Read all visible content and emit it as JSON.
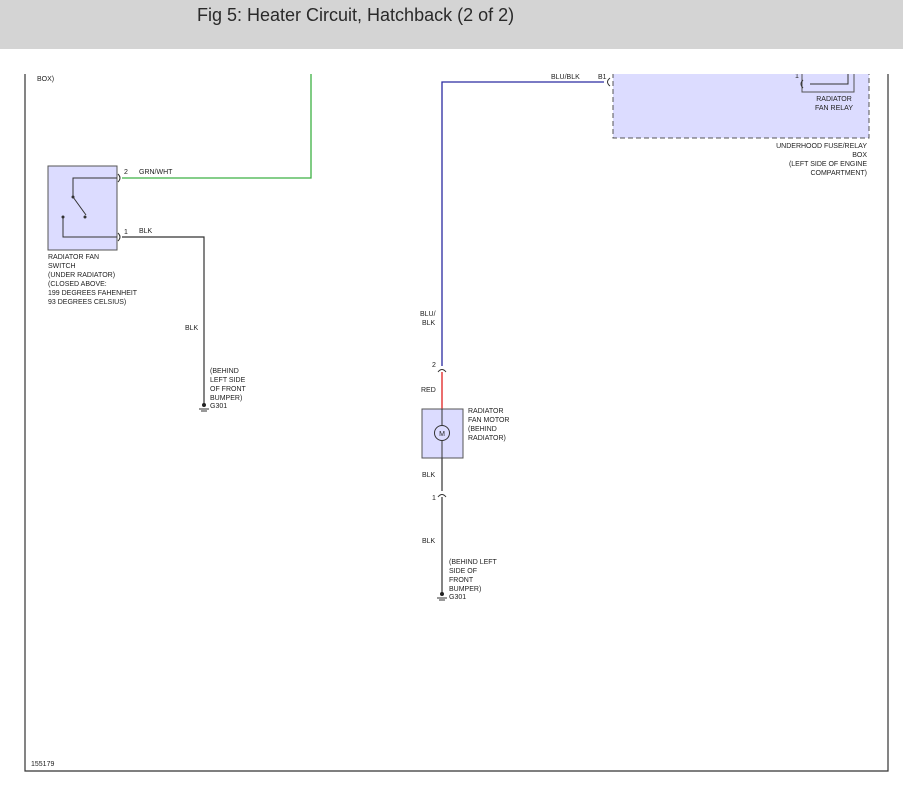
{
  "header": {
    "title": "Fig 5: Heater Circuit, Hatchback (2 of 2)"
  },
  "diagram": {
    "top_left_fragment": "BOX)",
    "switch": {
      "lines": [
        "RADIATOR FAN",
        "SWITCH",
        "(UNDER RADIATOR)",
        "(CLOSED ABOVE:",
        "199 DEGREES FAHENHEIT",
        "93 DEGREES CELSIUS)"
      ],
      "pin2": "2",
      "pin1": "1"
    },
    "wires": {
      "grn_wht": "GRN/WHT",
      "blk_top": "BLK",
      "blk_vertical": "BLK",
      "blu_blk_top": "BLU/BLK",
      "blu_blk_side_1": "BLU/",
      "blu_blk_side_2": "BLK",
      "red": "RED",
      "blk_motor_1": "BLK",
      "blk_motor_2": "BLK"
    },
    "ground_left": {
      "lines": [
        "(BEHIND",
        "LEFT SIDE",
        "OF FRONT",
        "BUMPER)"
      ],
      "id": "G301"
    },
    "fuse_box": {
      "pin": "B1",
      "relay_pin": "1",
      "relay_lines": [
        "RADIATOR",
        "FAN RELAY"
      ],
      "box_lines": [
        "UNDERHOOD FUSE/RELAY",
        "BOX",
        "(LEFT SIDE OF ENGINE",
        "COMPARTMENT)"
      ]
    },
    "motor": {
      "symbol": "M",
      "lines": [
        "RADIATOR",
        "FAN MOTOR",
        "(BEHIND",
        "RADIATOR)"
      ],
      "pin2": "2",
      "pin1": "1"
    },
    "ground_right": {
      "lines": [
        "(BEHIND LEFT",
        "SIDE OF",
        "FRONT",
        "BUMPER)"
      ],
      "id": "G301"
    },
    "figure_id": "155179"
  },
  "colors": {
    "header_bg": "#d4d4d4",
    "green_wire": "#3cb043",
    "blue_wire": "#2a2aa0",
    "red_wire": "#e02020",
    "component_fill": "#dcdcff",
    "fuse_box_fill": "#dcdcff"
  }
}
